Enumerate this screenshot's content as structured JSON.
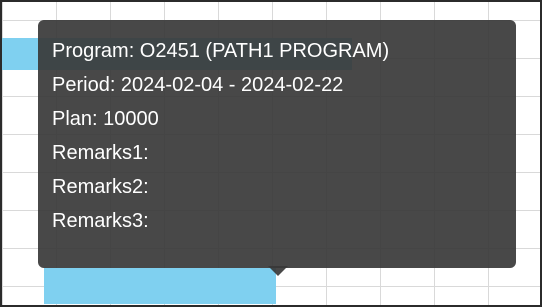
{
  "tooltip": {
    "program": "Program: O2451 (PATH1 PROGRAM)",
    "period": "Period: 2024-02-04 - 2024-02-22",
    "plan": "Plan: 10000",
    "remarks1": "Remarks1:",
    "remarks2": "Remarks2:",
    "remarks3": "Remarks3:"
  }
}
